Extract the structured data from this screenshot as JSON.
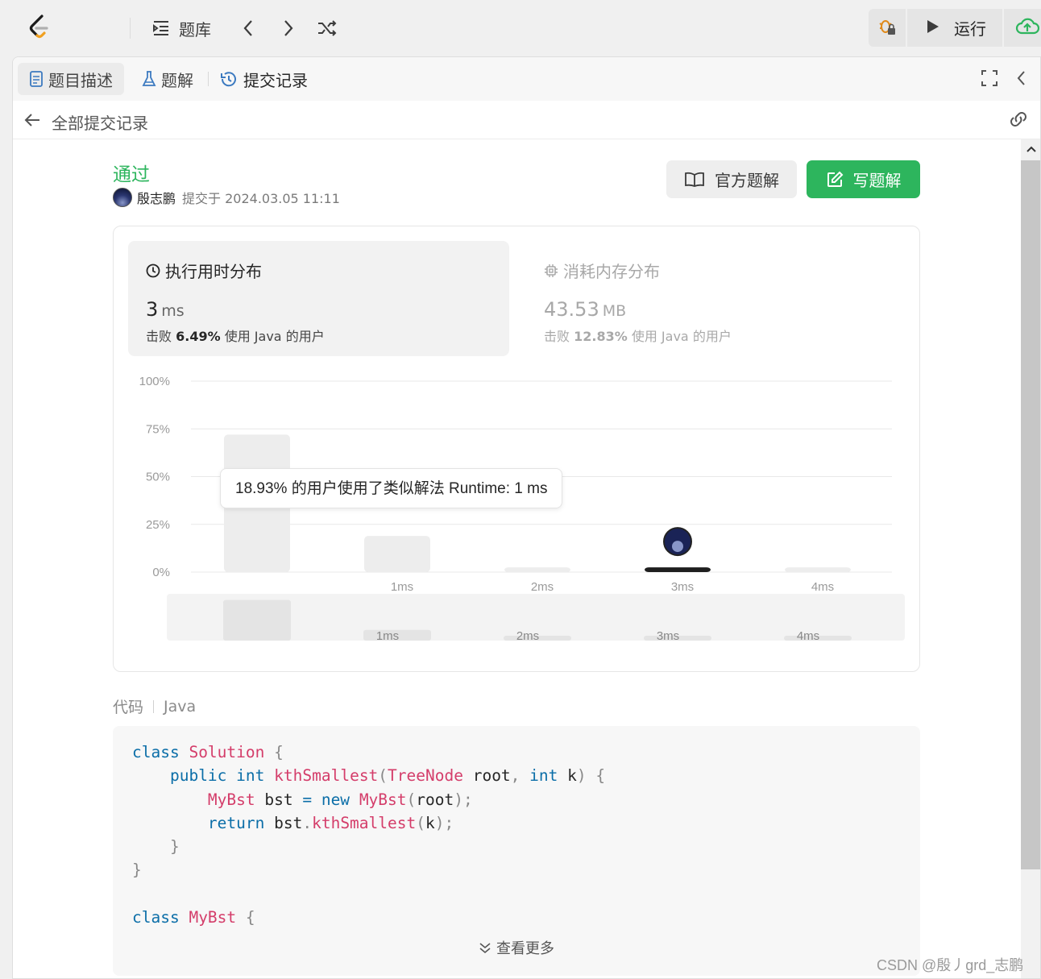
{
  "topbar": {
    "problem_list_label": "题库",
    "run_label": "运行"
  },
  "tabs": [
    {
      "label": "题目描述"
    },
    {
      "label": "题解"
    },
    {
      "label": "提交记录"
    }
  ],
  "subheader": {
    "back_label": "全部提交记录"
  },
  "submission": {
    "status": "通过",
    "author": "殷志鹏",
    "submitted_at": "提交于 2024.03.05 11:11",
    "official_solution_label": "官方题解",
    "write_solution_label": "写题解"
  },
  "runtime": {
    "title": "执行用时分布",
    "value": "3",
    "unit": "ms",
    "beat_prefix": "击败",
    "beat_percent": "6.49%",
    "beat_suffix": "使用 Java 的用户"
  },
  "memory": {
    "title": "消耗内存分布",
    "value": "43.53",
    "unit": "MB",
    "beat_prefix": "击败",
    "beat_percent": "12.83%",
    "beat_suffix": "使用 Java 的用户"
  },
  "tooltip": "18.93% 的用户使用了类似解法 Runtime: 1 ms",
  "chart_data": {
    "type": "bar",
    "categories": [
      "",
      "1ms",
      "2ms",
      "3ms",
      "4ms"
    ],
    "values": [
      72,
      18.93,
      2.5,
      2.5,
      2.5
    ],
    "highlight_index": 3,
    "y_ticks": [
      "0%",
      "25%",
      "50%",
      "75%",
      "100%"
    ],
    "ylim": [
      0,
      100
    ],
    "grid": true,
    "colors": {
      "bar": "#ededed",
      "highlight": "#1f1f1f",
      "grid": "#e8e8e8",
      "tick": "#9a9a9a"
    }
  },
  "code": {
    "label": "代码",
    "language": "Java",
    "more_label": "查看更多"
  },
  "watermark": "CSDN @殷丿grd_志鹏"
}
